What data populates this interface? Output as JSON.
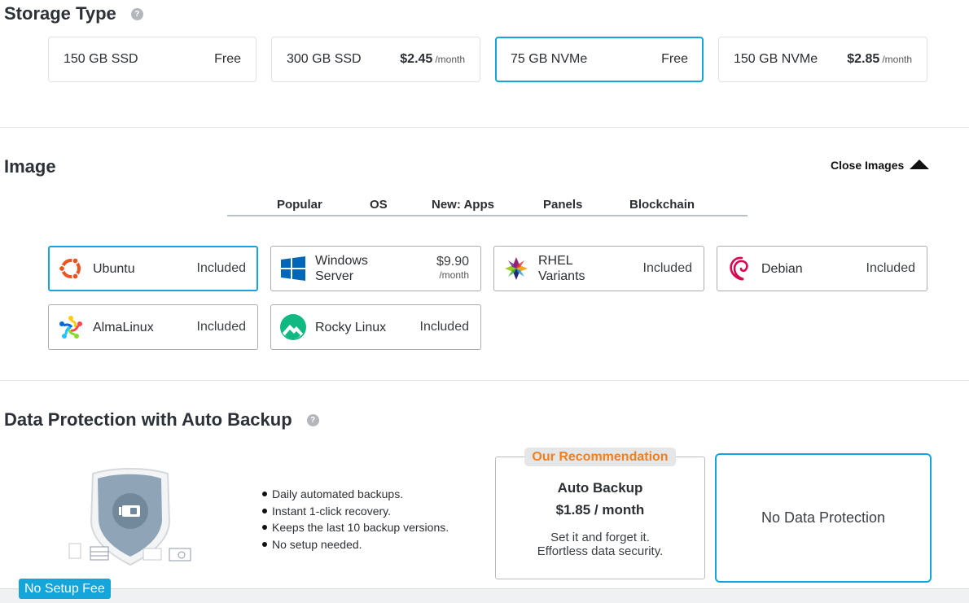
{
  "storage": {
    "title": "Storage Type",
    "help": "?",
    "options": [
      {
        "label": "150 GB SSD",
        "free": "Free"
      },
      {
        "label": "300 GB SSD",
        "price": "$2.45",
        "period": "/month"
      },
      {
        "label": "75 GB NVMe",
        "free": "Free",
        "selected": true
      },
      {
        "label": "150 GB NVMe",
        "price": "$2.85",
        "period": "/month"
      }
    ]
  },
  "image": {
    "title": "Image",
    "close_label": "Close Images",
    "tabs": [
      "Popular",
      "OS",
      "New: Apps",
      "Panels",
      "Blockchain"
    ],
    "os": [
      {
        "name": "Ubuntu",
        "status": "Included",
        "icon": "ubuntu-icon",
        "selected": true
      },
      {
        "name_line1": "Windows",
        "name_line2": "Server",
        "price": "$9.90",
        "period": "/month",
        "icon": "windows-icon"
      },
      {
        "name_line1": "RHEL",
        "name_line2": "Variants",
        "status": "Included",
        "icon": "rhel-icon"
      },
      {
        "name": "Debian",
        "status": "Included",
        "icon": "debian-icon"
      },
      {
        "name": "AlmaLinux",
        "status": "Included",
        "icon": "almalinux-icon"
      },
      {
        "name": "Rocky Linux",
        "status": "Included",
        "icon": "rocky-linux-icon"
      }
    ]
  },
  "backup": {
    "title": "Data Protection with Auto Backup",
    "help": "?",
    "bullets": [
      "Daily automated backups.",
      "Instant 1-click recovery.",
      "Keeps the last 10 backup versions.",
      "No setup needed."
    ],
    "recommendation_badge": "Our Recommendation",
    "rec_title": "Auto Backup",
    "rec_price": "$1.85 / month",
    "rec_desc_line1": "Set it and forget it.",
    "rec_desc_line2": "Effortless data security.",
    "no_protection": "No Data Protection"
  },
  "footer": {
    "setup_badge": "No Setup Fee"
  },
  "colors": {
    "accent": "#14a6da",
    "recommendation": "#f07f1e"
  }
}
